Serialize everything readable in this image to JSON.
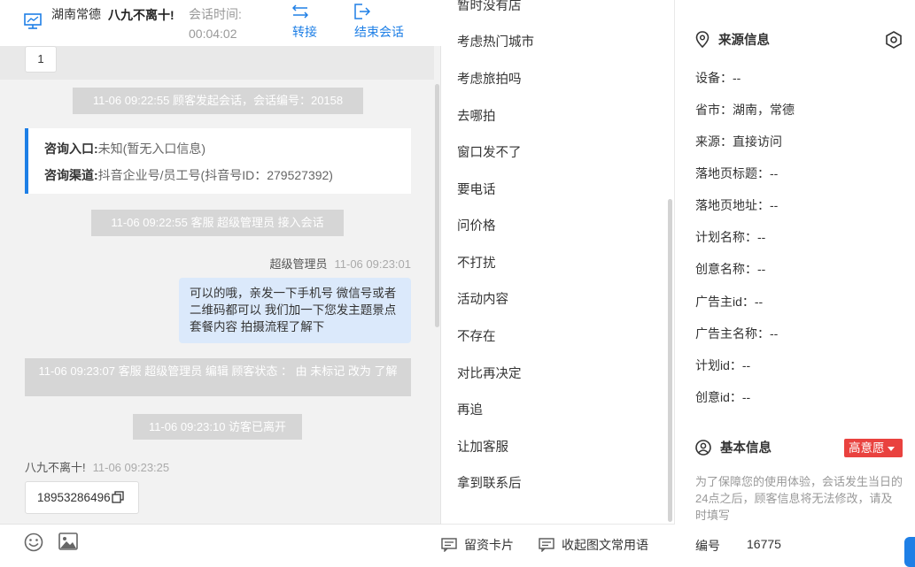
{
  "header": {
    "location": "湖南常德",
    "visitor_name": "八九不离十!",
    "time_label": "会话时间:",
    "time_value": "00:04:02",
    "transfer_label": "转接",
    "end_label": "结束会话"
  },
  "chat": {
    "first_bubble": "1",
    "sys_start": "11-06 09:22:55 顾客发起会话，会话编号：20158",
    "source_card": {
      "entry_label": "咨询入口:",
      "entry_value": "未知(暂无入口信息)",
      "channel_label": "咨询渠道:",
      "channel_value": "抖音企业号/员工号(抖音号ID：279527392)"
    },
    "sys_join": "11-06 09:22:55 客服 超级管理员 接入会话",
    "agent_name": "超级管理员",
    "agent_time": "11-06 09:23:01",
    "agent_message": "可以的哦，亲发一下手机号 微信号或者二维码都可以 我们加一下您发主题景点 套餐内容 拍摄流程了解下",
    "sys_edit": "11-06 09:23:07 客服 超级管理员 编辑 顾客状态 ： 由 未标记 改为 了解",
    "sys_left": "11-06 09:23:10 访客已离开",
    "visitor_name": "八九不离十!",
    "visitor_time": "11-06 09:23:25",
    "visitor_phone": "18953286496"
  },
  "phrases": [
    "暂时没有店",
    "考虑热门城市",
    "考虑旅拍吗",
    "去哪拍",
    "窗口发不了",
    "要电话",
    "问价格",
    "不打扰",
    "活动内容",
    "不存在",
    "对比再决定",
    "再追",
    "让加客服",
    "拿到联系后"
  ],
  "phrase_footer": {
    "card_label": "留资卡片",
    "collapse_label": "收起图文常用语"
  },
  "info": {
    "source_title": "来源信息",
    "rows": [
      "设备：--",
      "省市：湖南，常德",
      "来源：直接访问",
      "落地页标题：--",
      "落地页地址：--",
      "计划名称：--",
      "创意名称：--",
      "广告主id：--",
      "广告主名称：--",
      "计划id：--",
      "创意id：--"
    ],
    "basic_title": "基本信息",
    "intent_badge": "高意愿",
    "notice": "为了保障您的使用体验，会话发生当日的24点之后，顾客信息将无法修改，请及时填写",
    "code_label": "编号",
    "code_value": "16775"
  },
  "colors": {
    "accent": "#1e7fe6",
    "agent_bubble": "#dbe9fb",
    "badge_red": "#e9423f",
    "system_msg": "#d6d6d6"
  }
}
